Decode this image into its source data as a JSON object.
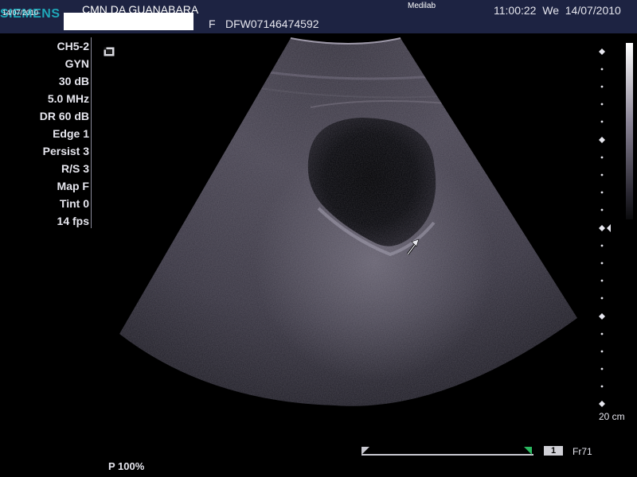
{
  "header": {
    "brand": "SIEMENS",
    "small_date": "14/07/2010",
    "institution": "CMN DA GUANABARA",
    "patient_sex": "F",
    "patient_id": "DFW07146474592",
    "app_name": "Medilab",
    "clock": "11:00:22  We  14/07/2010"
  },
  "parameters": [
    "CH5-2",
    "GYN",
    "30 dB",
    "5.0 MHz",
    "DR 60 dB",
    "Edge 1",
    "Persist 3",
    "R/S 3",
    "Map F",
    "Tint 0",
    "14 fps"
  ],
  "depth": {
    "label": "20 cm"
  },
  "footer": {
    "power": "P 100%",
    "frame_number": "1",
    "frame_label": "Fr71"
  },
  "colors": {
    "header_bg": "#1d2342",
    "brand": "#1fa7b8",
    "cine_marker": "#2bb860"
  },
  "icons": {
    "frame_icon": "square-frame-icon",
    "annotation_arrow": "arrow-icon"
  }
}
